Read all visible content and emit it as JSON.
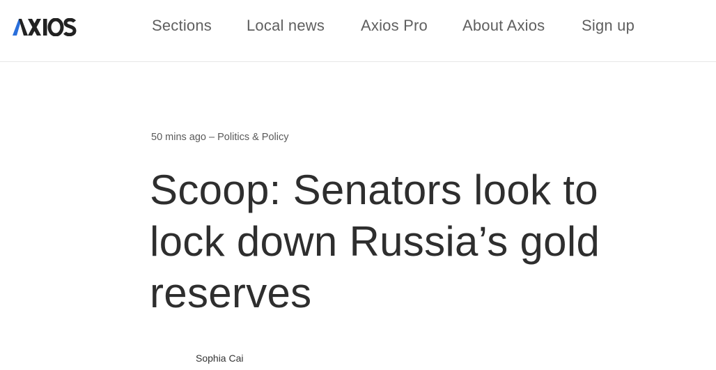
{
  "brand": {
    "logo_text": "AXIOS",
    "accent_color": "#2a6fdb"
  },
  "nav": {
    "items": [
      {
        "label": "Sections"
      },
      {
        "label": "Local news"
      },
      {
        "label": "Axios Pro"
      },
      {
        "label": "About Axios"
      },
      {
        "label": "Sign up"
      }
    ]
  },
  "article": {
    "timestamp": "50 mins ago",
    "separator": "–",
    "category": "Politics & Policy",
    "headline": "Scoop: Senators look to lock down Russia’s gold reserves",
    "author": "Sophia Cai"
  }
}
